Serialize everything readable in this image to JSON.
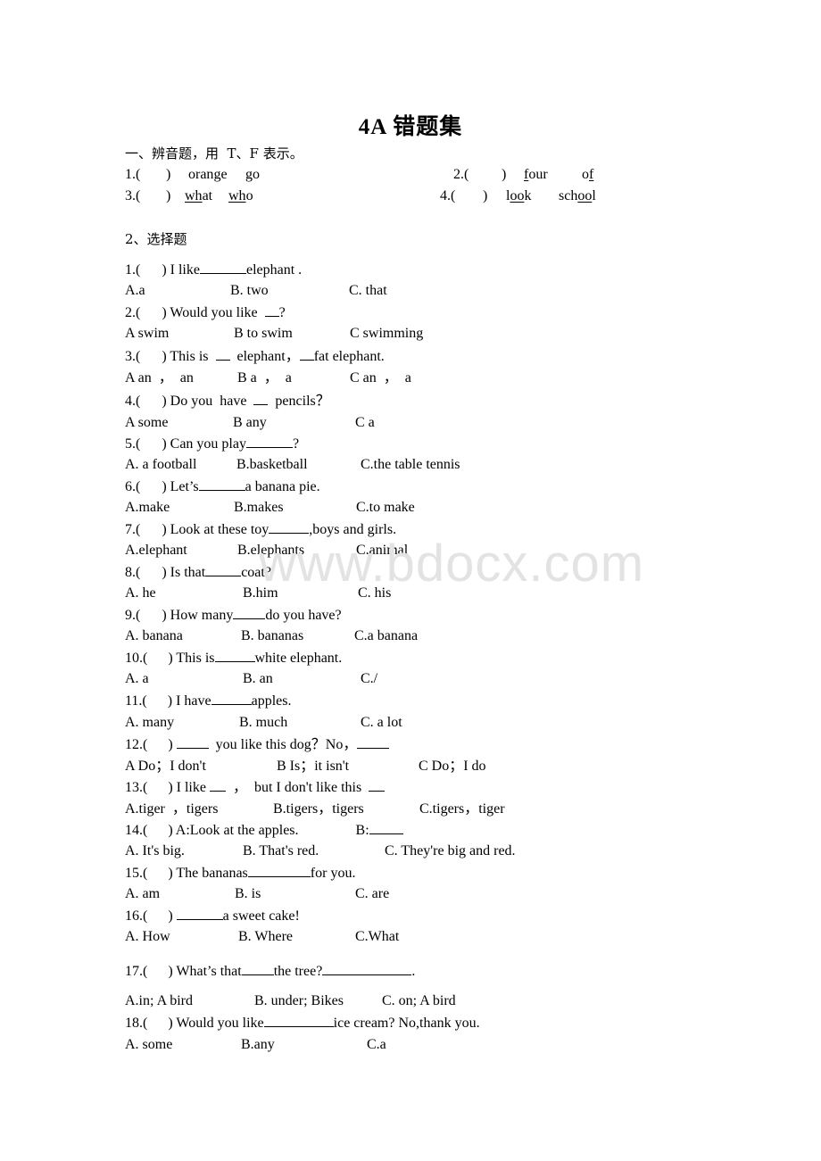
{
  "title": "4A 错题集",
  "watermark": "www.bdocx.com",
  "section1": {
    "heading": "一、辨音题，用  T、F 表示。",
    "items": [
      {
        "num": "1.(",
        "close": ")",
        "word1": {
          "pre": "oran",
          "u": "g",
          "post": "e"
        },
        "word2": {
          "pre": "",
          "u": "g",
          "post": "o"
        }
      },
      {
        "num": "2.(",
        "close": ")",
        "word1": {
          "pre": "",
          "u": "f",
          "post": "our"
        },
        "word2": {
          "pre": "o",
          "u": "f",
          "post": ""
        }
      },
      {
        "num": "3.(",
        "close": ")",
        "word1": {
          "pre": "",
          "u": "wh",
          "post": "at"
        },
        "word2": {
          "pre": "",
          "u": "wh",
          "post": "o"
        }
      },
      {
        "num": "4.(",
        "close": ")",
        "word1": {
          "pre": "l",
          "u": "oo",
          "post": "k"
        },
        "word2": {
          "pre": "sch",
          "u": "oo",
          "post": "l"
        }
      }
    ]
  },
  "section2": {
    "heading": "2、选择题",
    "questions": [
      {
        "num": "1.(",
        "close": ")",
        "stem_parts": [
          "I like",
          "elephant ."
        ],
        "blanks": [
          52
        ],
        "options": [
          "A.a",
          "B. two",
          "C. that"
        ]
      },
      {
        "num": "2.(",
        "close": ")",
        "stem_parts": [
          "Would you like  ",
          "?"
        ],
        "blanks": [
          16
        ],
        "options": [
          "A swim",
          "B to swim",
          "C swimming"
        ]
      },
      {
        "num": "3.(",
        "close": ")",
        "stem_parts": [
          "This is  ",
          "  elephant，",
          "fat elephant."
        ],
        "blanks": [
          16,
          16
        ],
        "options": [
          "A an  ，  an",
          "B a  ，  a",
          "C an  ，  a"
        ]
      },
      {
        "num": "4.(",
        "close": ")",
        "stem_parts": [
          "Do you  have  ",
          "  pencils？"
        ],
        "blanks": [
          16
        ],
        "options": [
          "A some",
          "B any",
          "C a"
        ]
      },
      {
        "num": "5.(",
        "close": ")",
        "stem_parts": [
          "Can you play",
          "?"
        ],
        "blanks": [
          52
        ],
        "options": [
          "A. a football",
          "B.basketball",
          "C.the table tennis"
        ]
      },
      {
        "num": "6.(",
        "close": ")",
        "stem_parts": [
          "Let’s",
          "a banana pie."
        ],
        "blanks": [
          52
        ],
        "options": [
          "A.make",
          "B.makes",
          "C.to make"
        ]
      },
      {
        "num": "7.(",
        "close": ")",
        "stem_parts": [
          "Look at these toy",
          ",boys and girls."
        ],
        "blanks": [
          45
        ],
        "options": [
          "A.elephant",
          "B.elephants",
          "C.animal"
        ]
      },
      {
        "num": "8.(",
        "close": ")",
        "stem_parts": [
          "Is that",
          "coat?"
        ],
        "blanks": [
          40
        ],
        "options": [
          "A. he",
          "B.him",
          "C. his"
        ]
      },
      {
        "num": "9.(",
        "close": ")",
        "stem_parts": [
          "How many",
          "do you have?"
        ],
        "blanks": [
          36
        ],
        "options": [
          "A. banana",
          "B. bananas",
          "C.a banana"
        ]
      },
      {
        "num": "10.(",
        "close": ")",
        "stem_parts": [
          "This is",
          "white elephant."
        ],
        "blanks": [
          45
        ],
        "options": [
          "A. a",
          "B. an",
          "C./"
        ]
      },
      {
        "num": "11.(",
        "close": ")",
        "stem_parts": [
          "I have",
          "apples."
        ],
        "blanks": [
          45
        ],
        "options": [
          "A. many",
          "B. much",
          "C. a lot"
        ]
      },
      {
        "num": "12.(",
        "close": ")",
        "stem_parts": [
          "",
          "  you like this dog？No，",
          ""
        ],
        "blanks": [
          36,
          36
        ],
        "options": [
          "A Do；I don't",
          "B Is；it isn't",
          "C Do；I do"
        ]
      },
      {
        "num": "13.(",
        "close": ")",
        "stem_parts": [
          "I like ",
          "  ，  but I don't like this  ",
          ""
        ],
        "blanks": [
          18,
          18
        ],
        "options": [
          "A.tiger  ，tigers",
          "B.tigers，tigers",
          "C.tigers，tiger"
        ]
      },
      {
        "num": "14.(",
        "close": ")",
        "stem_parts": [
          "A:Look at the apples.",
          ""
        ],
        "stem_b": "B:",
        "blanks": [
          38
        ],
        "options": [
          "A. It's big.",
          "B. That's red.",
          "C. They're big and red."
        ]
      },
      {
        "num": "15.(",
        "close": ")",
        "stem_parts": [
          "The bananas",
          "for you."
        ],
        "blanks": [
          70
        ],
        "options": [
          "A. am",
          "B. is",
          "C. are"
        ]
      },
      {
        "num": "16.(",
        "close": ")",
        "stem_parts": [
          "",
          "a sweet cake!"
        ],
        "blanks": [
          52
        ],
        "options": [
          "A. How",
          "B. Where",
          "C.What"
        ]
      },
      {
        "num": "17.(",
        "close": ")",
        "stem_parts": [
          "What’s that",
          "the tree?",
          "."
        ],
        "blanks": [
          36,
          100
        ],
        "options": [
          "A.in; A bird",
          "B. under; Bikes",
          "C. on; A bird"
        ]
      },
      {
        "num": "18.(",
        "close": ")",
        "stem_parts": [
          "Would you like",
          "ice cream? No,thank you."
        ],
        "blanks": [
          78
        ],
        "options": [
          "A. some",
          "B.any",
          "C.a"
        ]
      }
    ]
  }
}
